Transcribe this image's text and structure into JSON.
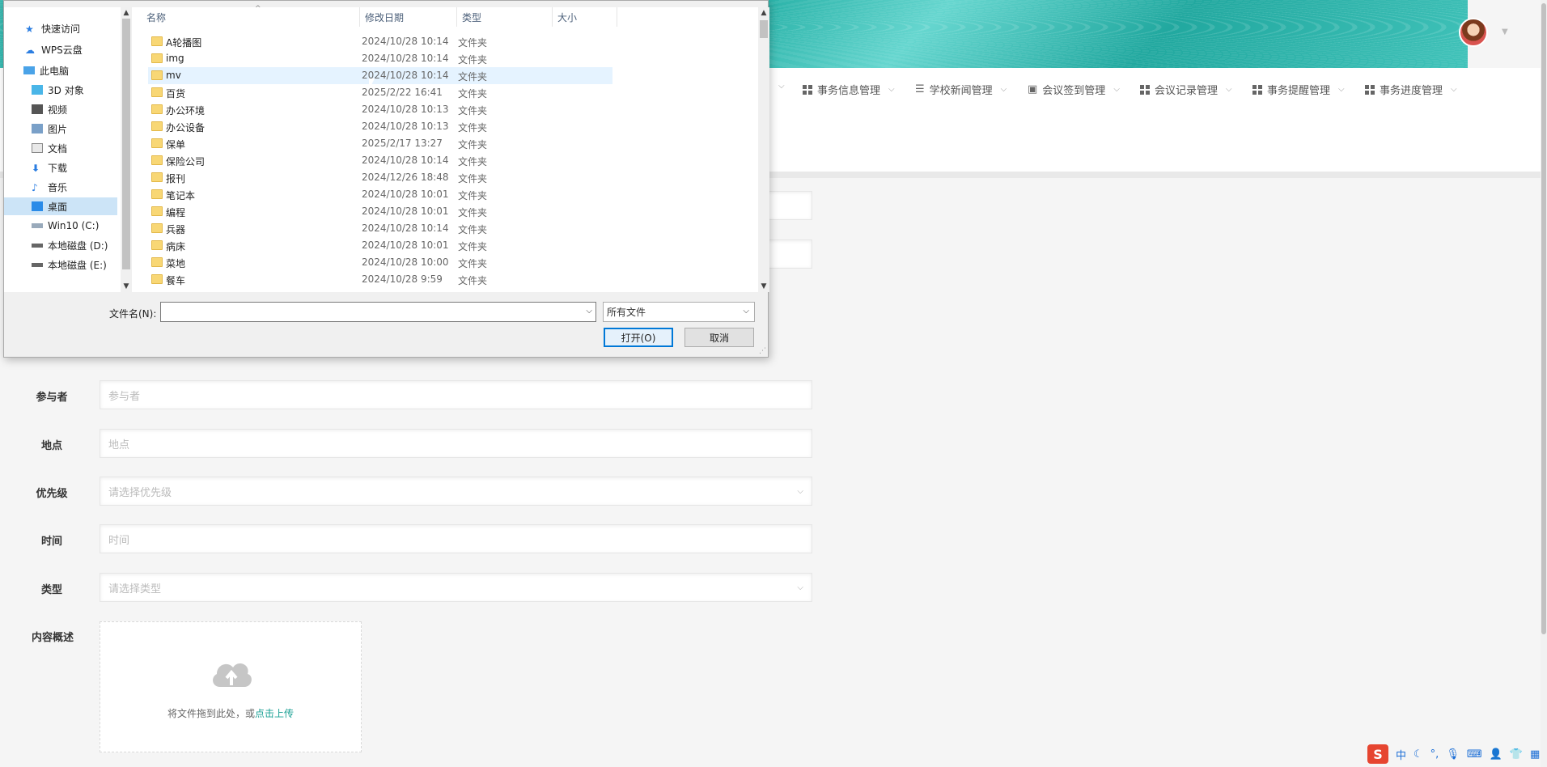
{
  "nav": {
    "items": [
      {
        "label": "事务信息管理"
      },
      {
        "label": "学校新闻管理"
      },
      {
        "label": "会议签到管理"
      },
      {
        "label": "会议记录管理"
      },
      {
        "label": "事务提醒管理"
      },
      {
        "label": "事务进度管理"
      }
    ]
  },
  "form": {
    "participants": {
      "label": "参与者",
      "placeholder": "参与者"
    },
    "location": {
      "label": "地点",
      "placeholder": "地点"
    },
    "priority": {
      "label": "优先级",
      "placeholder": "请选择优先级"
    },
    "time": {
      "label": "时间",
      "placeholder": "时间"
    },
    "type": {
      "label": "类型",
      "placeholder": "请选择类型"
    },
    "summary": {
      "label": "内容概述",
      "upload_text": "将文件拖到此处，或",
      "upload_link": "点击上传"
    }
  },
  "tray": {
    "ime": "中"
  },
  "dialog": {
    "sidebar": [
      {
        "label": "快速访问",
        "icon": "star-icon"
      },
      {
        "label": "WPS云盘",
        "icon": "cloud-icon"
      },
      {
        "label": "此电脑",
        "icon": "computer-icon"
      },
      {
        "label": "3D 对象",
        "icon": "cube-icon"
      },
      {
        "label": "视频",
        "icon": "video-icon"
      },
      {
        "label": "图片",
        "icon": "picture-icon"
      },
      {
        "label": "文档",
        "icon": "document-icon"
      },
      {
        "label": "下载",
        "icon": "download-icon"
      },
      {
        "label": "音乐",
        "icon": "music-icon"
      },
      {
        "label": "桌面",
        "icon": "desktop-icon",
        "selected": true
      },
      {
        "label": "Win10 (C:)",
        "icon": "drive-icon"
      },
      {
        "label": "本地磁盘 (D:)",
        "icon": "drive-icon"
      },
      {
        "label": "本地磁盘 (E:)",
        "icon": "drive-icon"
      }
    ],
    "columns": {
      "name": "名称",
      "date": "修改日期",
      "type": "类型",
      "size": "大小"
    },
    "files": [
      {
        "name": "A轮播图",
        "date": "2024/10/28 10:14",
        "type": "文件夹"
      },
      {
        "name": "img",
        "date": "2024/10/28 10:14",
        "type": "文件夹"
      },
      {
        "name": "mv",
        "date": "2024/10/28 10:14",
        "type": "文件夹"
      },
      {
        "name": "百货",
        "date": "2025/2/22 16:41",
        "type": "文件夹"
      },
      {
        "name": "办公环境",
        "date": "2024/10/28 10:13",
        "type": "文件夹"
      },
      {
        "name": "办公设备",
        "date": "2024/10/28 10:13",
        "type": "文件夹"
      },
      {
        "name": "保单",
        "date": "2025/2/17 13:27",
        "type": "文件夹"
      },
      {
        "name": "保险公司",
        "date": "2024/10/28 10:14",
        "type": "文件夹"
      },
      {
        "name": "报刊",
        "date": "2024/12/26 18:48",
        "type": "文件夹"
      },
      {
        "name": "笔记本",
        "date": "2024/10/28 10:01",
        "type": "文件夹"
      },
      {
        "name": "编程",
        "date": "2024/10/28 10:01",
        "type": "文件夹"
      },
      {
        "name": "兵器",
        "date": "2024/10/28 10:14",
        "type": "文件夹"
      },
      {
        "name": "病床",
        "date": "2024/10/28 10:01",
        "type": "文件夹"
      },
      {
        "name": "菜地",
        "date": "2024/10/28 10:00",
        "type": "文件夹"
      },
      {
        "name": "餐车",
        "date": "2024/10/28 9:59",
        "type": "文件夹"
      }
    ],
    "filename_label": "文件名(N):",
    "filename_value": "",
    "filetype": "所有文件",
    "open_button": "打开(O)",
    "cancel_button": "取消"
  }
}
